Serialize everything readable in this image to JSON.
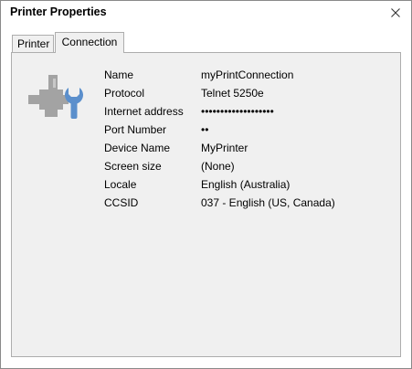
{
  "window": {
    "title": "Printer Properties"
  },
  "tabs": [
    {
      "label": "Printer",
      "selected": false
    },
    {
      "label": "Connection",
      "selected": true
    }
  ],
  "connection": {
    "icon": "connection-wrench-icon",
    "properties": [
      {
        "label": "Name",
        "value": "myPrintConnection"
      },
      {
        "label": "Protocol",
        "value": "Telnet 5250e"
      },
      {
        "label": "Internet address",
        "value": "•••••••••••••••••••"
      },
      {
        "label": "Port Number",
        "value": "••"
      },
      {
        "label": "Device Name",
        "value": "MyPrinter"
      },
      {
        "label": "Screen size",
        "value": "(None)"
      },
      {
        "label": "Locale",
        "value": "English (Australia)"
      },
      {
        "label": "CCSID",
        "value": "037 - English (US, Canada)"
      }
    ]
  },
  "colors": {
    "panel_bg": "#f0f0f0",
    "border": "#adadad",
    "icon_gray": "#a0a0a0",
    "icon_blue": "#5b8fcc"
  }
}
